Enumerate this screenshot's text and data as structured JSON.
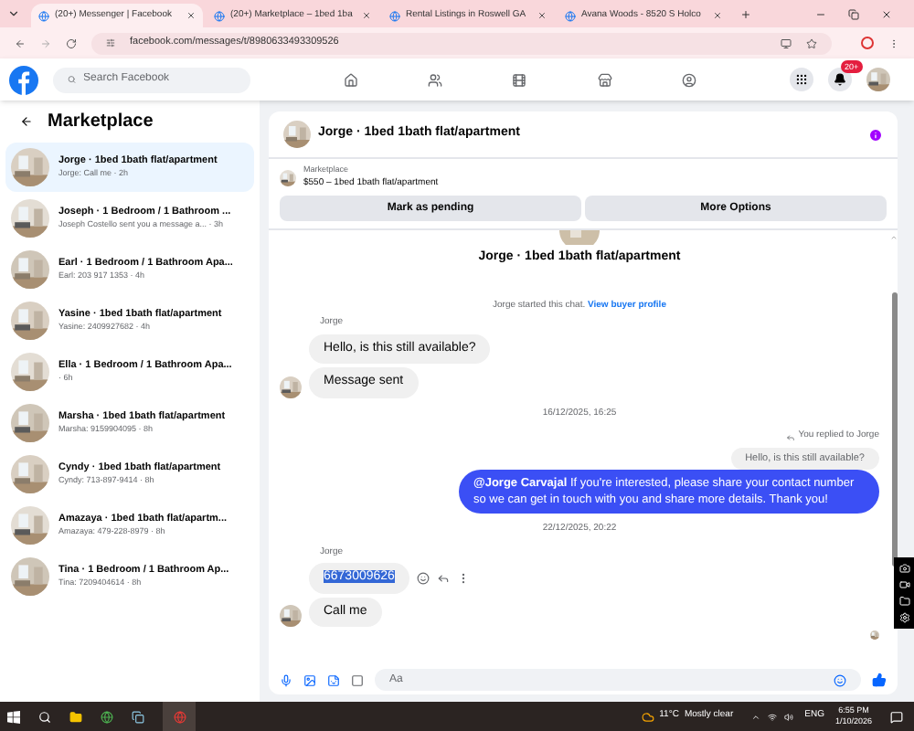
{
  "browser": {
    "tabs": [
      {
        "title": "(20+) Messenger | Facebook",
        "selected": true
      },
      {
        "title": "(20+) Marketplace – 1bed 1ba",
        "selected": false
      },
      {
        "title": "Rental Listings in Roswell GA",
        "selected": false
      },
      {
        "title": "Avana Woods - 8520 S Holco",
        "selected": false
      }
    ],
    "url": "facebook.com/messages/t/8980633493309526"
  },
  "nav": {
    "search_placeholder": "Search Facebook",
    "notification_badge": "20+"
  },
  "sidebar": {
    "title": "Marketplace",
    "conversations": [
      {
        "title": "Jorge · 1bed 1bath flat/apartment",
        "subtitle": "Jorge: Call me · 2h",
        "selected": true
      },
      {
        "title": "Joseph · 1 Bedroom / 1 Bathroom ...",
        "subtitle": "Joseph Costello sent you a message a... · 3h",
        "selected": false
      },
      {
        "title": "Earl · 1 Bedroom / 1 Bathroom Apa...",
        "subtitle": "Earl: 203 917 1353 · 4h",
        "selected": false
      },
      {
        "title": "Yasine · 1bed 1bath flat/apartment",
        "subtitle": "Yasine: 2409927682 · 4h",
        "selected": false
      },
      {
        "title": "Ella · 1 Bedroom / 1 Bathroom Apa...",
        "subtitle": "· 6h",
        "selected": false
      },
      {
        "title": "Marsha · 1bed 1bath flat/apartment",
        "subtitle": "Marsha: 9159904095 · 8h",
        "selected": false
      },
      {
        "title": "Cyndy · 1bed 1bath flat/apartment",
        "subtitle": "Cyndy: 713-897-9414 · 8h",
        "selected": false
      },
      {
        "title": "Amazaya · 1bed 1bath flat/apartm...",
        "subtitle": "Amazaya: 479-228-8979 · 8h",
        "selected": false
      },
      {
        "title": "Tina · 1 Bedroom / 1 Bathroom Ap...",
        "subtitle": "Tina: 7209404614 · 8h",
        "selected": false
      }
    ]
  },
  "chat": {
    "title": "Jorge · 1bed 1bath flat/apartment",
    "listing_label": "Marketplace",
    "listing_text": "$550 – 1bed 1bath flat/apartment",
    "actions": [
      "Mark as pending",
      "More Options"
    ],
    "intro_title": "Jorge · 1bed 1bath flat/apartment",
    "started_text": "Jorge started this chat.",
    "started_link": "View buyer profile",
    "messages": [
      {
        "kind": "sender",
        "text": "Jorge"
      },
      {
        "kind": "incoming",
        "text": "Hello, is this still available?",
        "avatar": false,
        "selected": false
      },
      {
        "kind": "incoming",
        "text": "Message sent",
        "avatar": true,
        "selected": false
      },
      {
        "kind": "time",
        "text": "16/12/2025, 16:25"
      },
      {
        "kind": "reply_note",
        "text": "You replied to Jorge"
      },
      {
        "kind": "quote",
        "text": "Hello, is this still available?"
      },
      {
        "kind": "outgoing",
        "text": "**@Jorge Carvajal** If you're interested, please share your contact number so we can get in touch with you and share more details. Thank you!"
      },
      {
        "kind": "time",
        "text": "22/12/2025, 20:22"
      },
      {
        "kind": "sender",
        "text": "Jorge"
      },
      {
        "kind": "incoming",
        "text": "6673009626",
        "avatar": false,
        "selected": true
      },
      {
        "kind": "incoming",
        "text": "Call me",
        "avatar": true,
        "selected": false
      }
    ],
    "composer_placeholder": "Aa"
  },
  "taskbar": {
    "temperature": "11°C",
    "weather": "Mostly clear",
    "language": "ENG",
    "time": "6:55 PM",
    "date": "1/10/2026"
  }
}
